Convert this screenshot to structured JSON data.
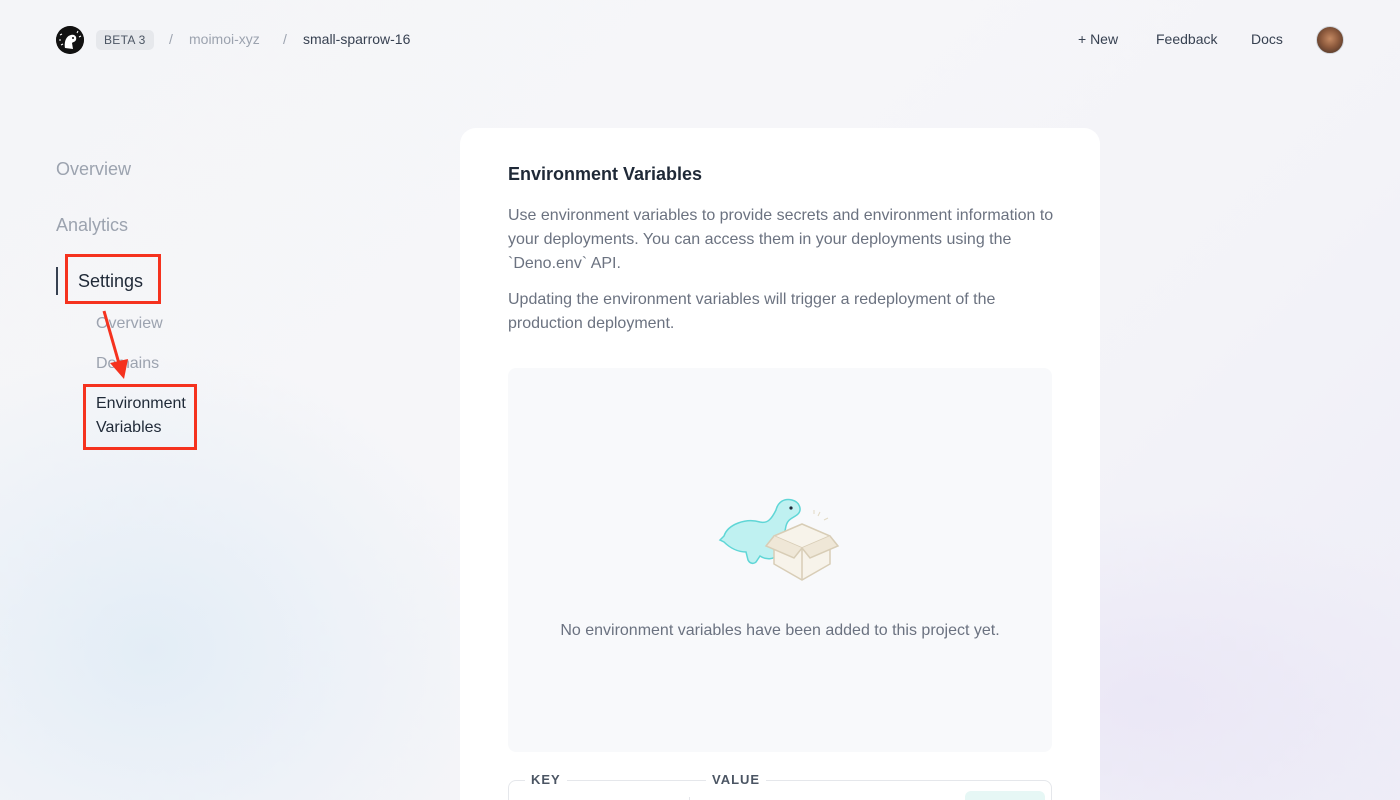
{
  "header": {
    "badge": "BETA 3",
    "separator": "/",
    "org": "moimoi-xyz",
    "project": "small-sparrow-16",
    "new_label": "+  New",
    "feedback_label": "Feedback",
    "docs_label": "Docs"
  },
  "sidebar": {
    "items": [
      {
        "label": "Overview"
      },
      {
        "label": "Analytics"
      },
      {
        "label": "Settings"
      }
    ],
    "sub_items": [
      {
        "label": "Overview"
      },
      {
        "label": "Domains"
      },
      {
        "label": "Environment Variables"
      }
    ]
  },
  "card": {
    "title": "Environment Variables",
    "description": "Use environment variables to provide secrets and environment information to your deployments. You can access them in your deployments using the `Deno.env` API.",
    "description2": "Updating the environment variables will trigger a redeployment of the production deployment.",
    "empty_text": "No environment variables have been added to this project yet.",
    "key_label": "KEY",
    "value_label": "VALUE"
  },
  "colors": {
    "highlight": "#f5321e",
    "accent": "#7fe3e3"
  }
}
